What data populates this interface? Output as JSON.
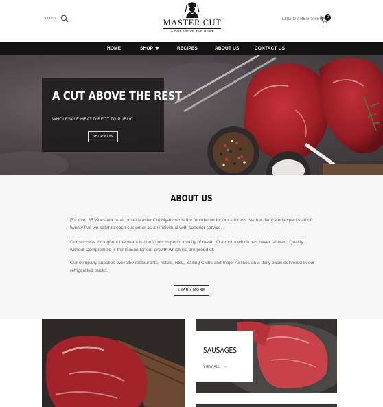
{
  "header": {
    "search_label": "Search",
    "logo_title": "MASTER CUT",
    "logo_tagline": "A CUT ABOVE THE REST",
    "login_label": "LOGIN / REGISTER",
    "cart_count": "0"
  },
  "nav": {
    "items": [
      {
        "label": "HOME"
      },
      {
        "label": "SHOP"
      },
      {
        "label": "RECIPES"
      },
      {
        "label": "ABOUT US"
      },
      {
        "label": "CONTACT US"
      }
    ]
  },
  "hero": {
    "title": "A CUT ABOVE THE REST",
    "subtitle": "WHOLESALE MEAT DIRECT TO PUBLIC",
    "button_label": "SHOP NOW"
  },
  "about": {
    "title": "ABOUT US",
    "paragraphs": [
      "For over 35 years our retail outlet Master Cut Myanmar is the foundation for our success. With a dedicated expert staff of twenty five we cater to each customer as an individual with superior service.",
      "Our success throughout the years is due to our superior quality of meat . Our motto which has never faltered: Quality without Compromise is the reason for our growth which we are proud of.",
      "Our company supplies over 250 restaurants, hotels, RSL, Sailing Clubs and major Airlines on a daily basis delivered in our refrigerated trucks."
    ],
    "button_label": "LEARN MORE"
  },
  "products": {
    "card_title": "SAUSAGES",
    "card_link": "VIEW ALL"
  },
  "colors": {
    "nav_bg": "#121212",
    "hero_box_bg": "#191617",
    "about_bg": "#f6f6f6"
  }
}
